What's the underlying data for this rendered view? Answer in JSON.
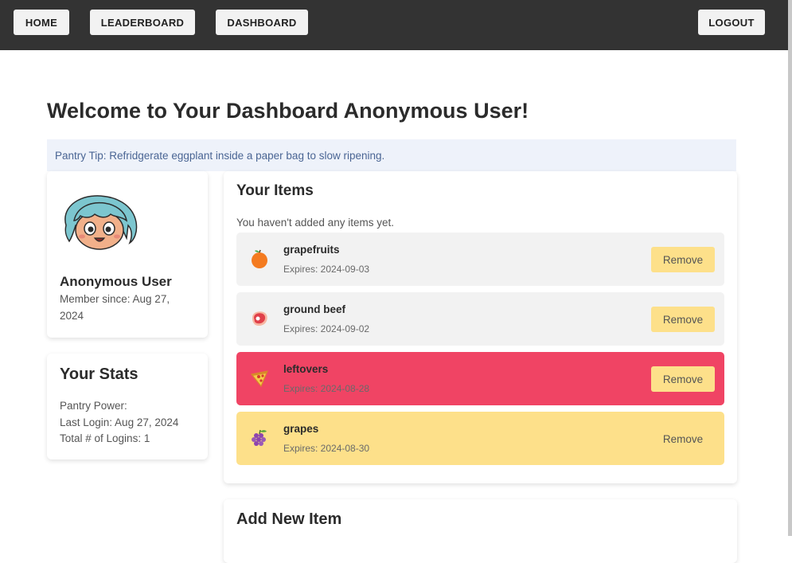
{
  "nav": {
    "home": "HOME",
    "leaderboard": "LEADERBOARD",
    "dashboard": "DASHBOARD",
    "logout": "LOGOUT"
  },
  "page": {
    "title": "Welcome to Your Dashboard Anonymous User!",
    "tip": "Pantry Tip: Refridgerate eggplant inside a paper bag to slow ripening."
  },
  "profile": {
    "name": "Anonymous User",
    "member_since": "Member since: Aug 27, 2024"
  },
  "stats": {
    "title": "Your Stats",
    "pantry_power": "Pantry Power:",
    "last_login": "Last Login: Aug 27, 2024",
    "total_logins": "Total # of Logins: 1"
  },
  "items": {
    "title": "Your Items",
    "empty_message": "You haven't added any items yet.",
    "list": [
      {
        "name": "grapefruits",
        "expires": "Expires: 2024-09-03",
        "icon": "orange-icon",
        "status_color": "#f2f2f2",
        "remove": "Remove"
      },
      {
        "name": "ground beef",
        "expires": "Expires: 2024-09-02",
        "icon": "meat-icon",
        "status_color": "#f2f2f2",
        "remove": "Remove"
      },
      {
        "name": "leftovers",
        "expires": "Expires: 2024-08-28",
        "icon": "pizza-icon",
        "status_color": "#f04464",
        "remove": "Remove"
      },
      {
        "name": "grapes",
        "expires": "Expires: 2024-08-30",
        "icon": "grapes-icon",
        "status_color": "#fde08a",
        "remove": "Remove"
      }
    ]
  },
  "add_item": {
    "title": "Add New Item"
  },
  "colors": {
    "nav_bg": "#333333",
    "remove_button": "#fde08a",
    "expired": "#f04464",
    "expiring_soon": "#fde08a",
    "normal": "#f2f2f2"
  }
}
